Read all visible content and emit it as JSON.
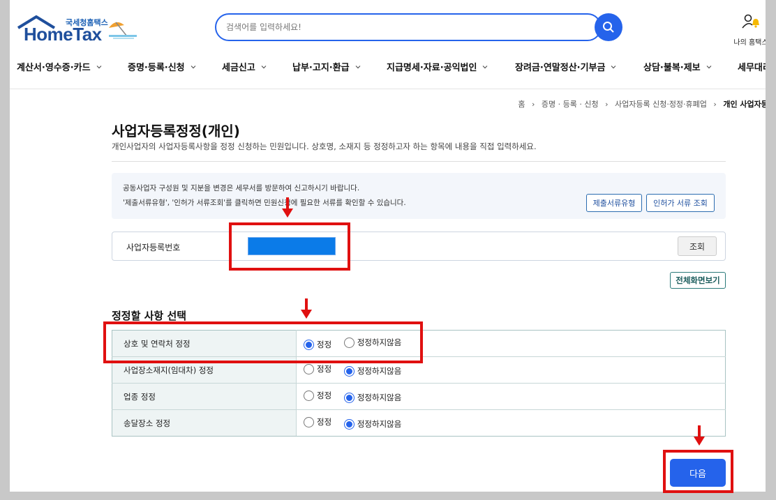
{
  "header": {
    "logo_sub": "국세청홈택스",
    "logo_main": "HomeTax",
    "search_placeholder": "검색어를 입력하세요!",
    "myhome_label": "나의 홈택스"
  },
  "nav": {
    "items": [
      {
        "label": "계산서·영수증·카드"
      },
      {
        "label": "증명·등록·신청"
      },
      {
        "label": "세금신고"
      },
      {
        "label": "납부·고지·환급"
      },
      {
        "label": "지급명세·자료·공익법인"
      },
      {
        "label": "장려금·연말정산·기부금"
      },
      {
        "label": "상담·불복·제보"
      },
      {
        "label": "세무대리·"
      }
    ]
  },
  "breadcrumb": {
    "items": [
      "홈",
      "증명 · 등록 · 신청",
      "사업자등록 신청·정정·휴폐업"
    ],
    "current": "개인 사업자등록"
  },
  "page": {
    "title": "사업자등록정정(개인)",
    "description": "개인사업자의 사업자등록사항을 정정 신청하는 민원입니다. 상호명, 소재지 등 정정하고자 하는 항목에 내용을 직접 입력하세요."
  },
  "info": {
    "line1": "공동사업자 구성원 및 지분을 변경은 세무서를 방문하여 신고하시기 바랍니다.",
    "line2": "'제출서류유형', '인허가 서류조회'를 클릭하면 민원신청에 필요한 서류를 확인할 수 있습니다.",
    "btn_doc_type": "제출서류유형",
    "btn_license": "인허가 서류 조회"
  },
  "biz": {
    "label": "사업자등록번호",
    "search_label": "조회"
  },
  "full_screen_label": "전체화면보기",
  "section_title": "정정할 사항 선택",
  "options": {
    "yes": "정정",
    "no": "정정하지않음"
  },
  "rows": [
    {
      "label": "상호 및 연락처 정정",
      "selected": "yes"
    },
    {
      "label": "사업장소재지(임대차) 정정",
      "selected": "no"
    },
    {
      "label": "업종 정정",
      "selected": "no"
    },
    {
      "label": "송달장소 정정",
      "selected": "no"
    }
  ],
  "next_label": "다음",
  "colors": {
    "primary": "#2563eb",
    "annotation": "#e01010",
    "brand": "#1f4f9c"
  }
}
